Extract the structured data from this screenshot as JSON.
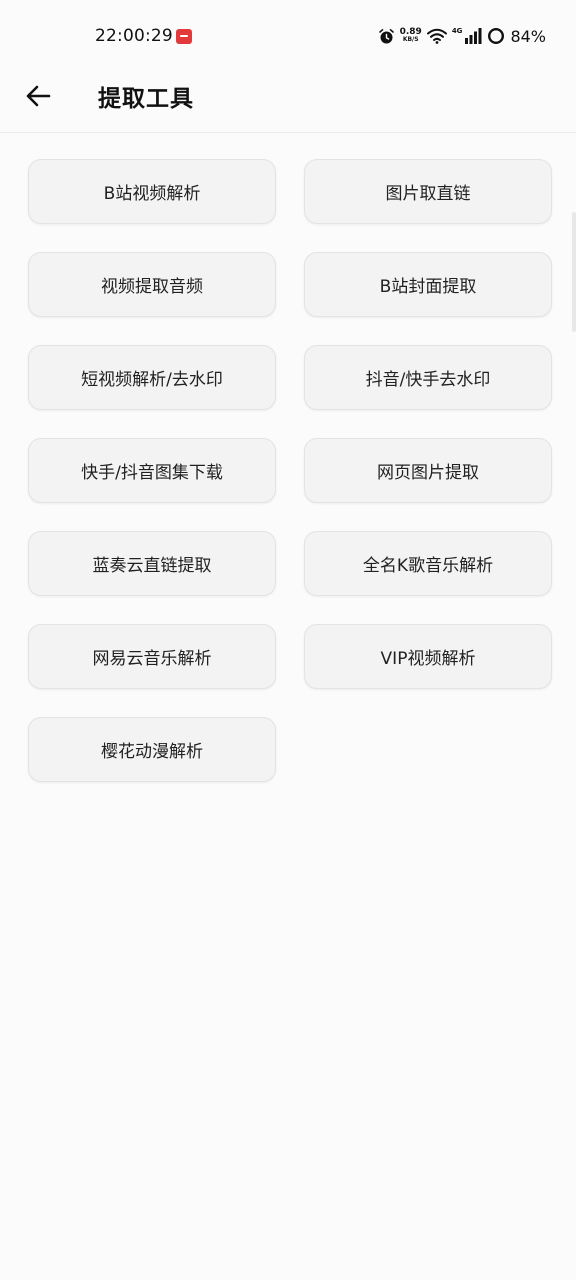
{
  "status_bar": {
    "time": "22:00:29",
    "net_speed_value": "0.89",
    "net_speed_unit": "KB/S",
    "network_label": "4G",
    "battery_percent": "84%"
  },
  "app_bar": {
    "title": "提取工具",
    "back_icon": "arrow-left-icon"
  },
  "tools": [
    {
      "label": "B站视频解析"
    },
    {
      "label": "图片取直链"
    },
    {
      "label": "视频提取音频"
    },
    {
      "label": "B站封面提取"
    },
    {
      "label": "短视频解析/去水印"
    },
    {
      "label": "抖音/快手去水印"
    },
    {
      "label": "快手/抖音图集下载"
    },
    {
      "label": "网页图片提取"
    },
    {
      "label": "蓝奏云直链提取"
    },
    {
      "label": "全名K歌音乐解析"
    },
    {
      "label": "网易云音乐解析"
    },
    {
      "label": "VIP视频解析"
    },
    {
      "label": "樱花动漫解析"
    }
  ],
  "colors": {
    "background": "#fbfbfb",
    "button_bg": "#f3f3f3",
    "button_border": "#e3e3e3",
    "notification_icon": "#e23a3a"
  }
}
